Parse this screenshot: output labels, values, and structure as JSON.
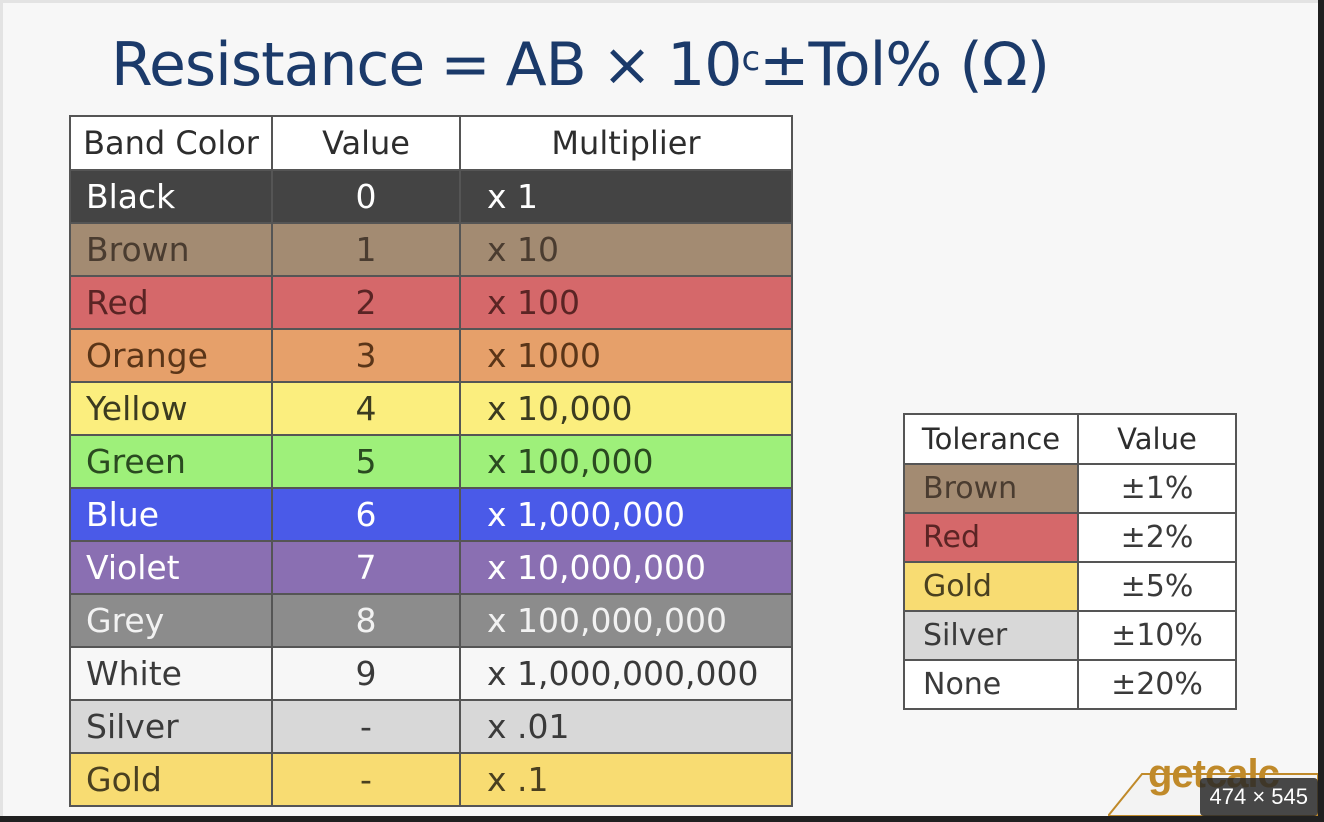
{
  "formula": {
    "left": "Resistance",
    "equals": "=",
    "ab": "AB",
    "times": "×",
    "base": "10",
    "exponent": "c",
    "plusminus": "±",
    "tol": "Tol%",
    "unit": "(Ω)"
  },
  "band_table": {
    "headers": [
      "Band Color",
      "Value",
      "Multiplier"
    ],
    "rows": [
      {
        "color": "Black",
        "value": "0",
        "multiplier": "x 1",
        "bg": "#444444",
        "fg": "#ffffff"
      },
      {
        "color": "Brown",
        "value": "1",
        "multiplier": "x 10",
        "bg": "#a38b72",
        "fg": "#4a3c30"
      },
      {
        "color": "Red",
        "value": "2",
        "multiplier": "x 100",
        "bg": "#d5686a",
        "fg": "#5a2424"
      },
      {
        "color": "Orange",
        "value": "3",
        "multiplier": "x 1000",
        "bg": "#e6a06a",
        "fg": "#5a3518"
      },
      {
        "color": "Yellow",
        "value": "4",
        "multiplier": "x 10,000",
        "bg": "#fbee7e",
        "fg": "#3b3b20"
      },
      {
        "color": "Green",
        "value": "5",
        "multiplier": "x 100,000",
        "bg": "#9ef07a",
        "fg": "#2a4a20"
      },
      {
        "color": "Blue",
        "value": "6",
        "multiplier": "x 1,000,000",
        "bg": "#4a5ae8",
        "fg": "#ffffff"
      },
      {
        "color": "Violet",
        "value": "7",
        "multiplier": "x 10,000,000",
        "bg": "#8a6fb2",
        "fg": "#ffffff"
      },
      {
        "color": "Grey",
        "value": "8",
        "multiplier": "x 100,000,000",
        "bg": "#8c8c8c",
        "fg": "#f2f2f2"
      },
      {
        "color": "White",
        "value": "9",
        "multiplier": "x 1,000,000,000",
        "bg": "#f7f7f7",
        "fg": "#3a3a3a"
      },
      {
        "color": "Silver",
        "value": "-",
        "multiplier": "x .01",
        "bg": "#d8d8d8",
        "fg": "#3a3a3a"
      },
      {
        "color": "Gold",
        "value": "-",
        "multiplier": "x .1",
        "bg": "#f8dc72",
        "fg": "#4a4020"
      }
    ]
  },
  "tolerance_table": {
    "headers": [
      "Tolerance",
      "Value"
    ],
    "rows": [
      {
        "name": "Brown",
        "value": "±1%",
        "bg": "#a38b72",
        "fg": "#4a3c30"
      },
      {
        "name": "Red",
        "value": "±2%",
        "bg": "#d5686a",
        "fg": "#5a2424"
      },
      {
        "name": "Gold",
        "value": "±5%",
        "bg": "#f8dc72",
        "fg": "#4a4020"
      },
      {
        "name": "Silver",
        "value": "±10%",
        "bg": "#d8d8d8",
        "fg": "#3a3a3a"
      },
      {
        "name": "None",
        "value": "±20%",
        "bg": "#ffffff",
        "fg": "#3a3a3a"
      }
    ]
  },
  "logo": {
    "text": "getcalc"
  },
  "image_size_badge": "474 × 545",
  "colors": {
    "formula": "#1b3a6a",
    "border": "#555555",
    "logo": "#c08a2a"
  }
}
